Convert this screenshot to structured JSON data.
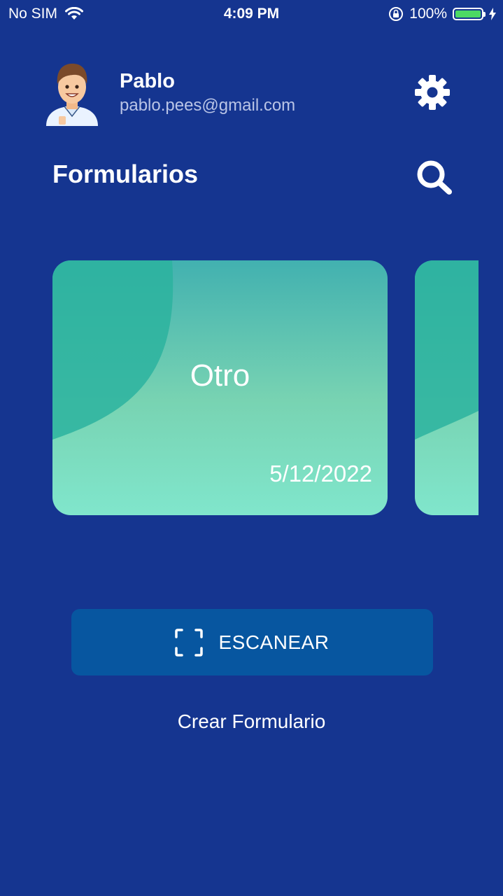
{
  "status_bar": {
    "carrier": "No SIM",
    "time": "4:09 PM",
    "battery": "100%",
    "battery_level": 1.0,
    "icons": [
      "wifi-icon",
      "orientation-lock-icon",
      "battery-icon",
      "charging-icon"
    ]
  },
  "profile": {
    "name": "Pablo",
    "email": "pablo.pees@gmail.com"
  },
  "section": {
    "title": "Formularios"
  },
  "cards": [
    {
      "title": "Otro",
      "date": "5/12/2022"
    }
  ],
  "actions": {
    "scan_label": "ESCANEAR",
    "create_label": "Crear Formulario"
  },
  "colors": {
    "background": "#153590",
    "scan_button": "#0756a0",
    "card_gradient_top": "#42b1b0",
    "card_gradient_bottom": "#80e6cc",
    "card_blob": "#2bb39f"
  }
}
